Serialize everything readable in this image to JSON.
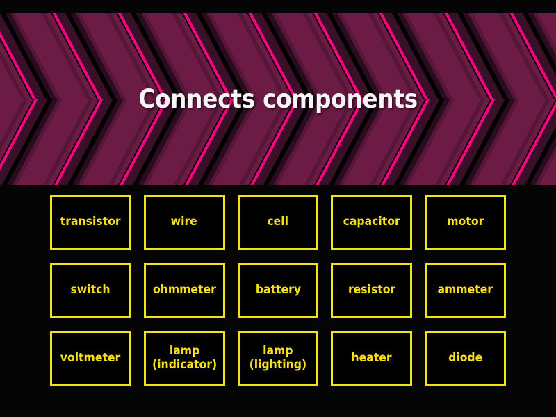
{
  "banner": {
    "title": "Connects components",
    "colors": {
      "background": "#000000",
      "chevron_main": "#6b1b44",
      "chevron_dark": "#3a1028",
      "chevron_mid": "#55163a",
      "chevron_bright": "#f0067f",
      "chevron_deep": "#2a0c1e",
      "title_text": "#f7f5f6"
    }
  },
  "page": {
    "background": "#050505",
    "tile_border": "#f2e414",
    "tile_background": "#000000",
    "tile_text": "#f7e017"
  },
  "grid": {
    "rows": [
      {
        "tiles": [
          {
            "label": "transistor"
          },
          {
            "label": "wire"
          },
          {
            "label": "cell"
          },
          {
            "label": "capacitor"
          },
          {
            "label": "motor"
          }
        ]
      },
      {
        "tiles": [
          {
            "label": "switch"
          },
          {
            "label": "ohmmeter"
          },
          {
            "label": "battery"
          },
          {
            "label": "resistor"
          },
          {
            "label": "ammeter"
          }
        ]
      },
      {
        "tiles": [
          {
            "label": "voltmeter"
          },
          {
            "label": "lamp\n(indicator)"
          },
          {
            "label": "lamp\n(lighting)"
          },
          {
            "label": "heater"
          },
          {
            "label": "diode"
          }
        ]
      }
    ]
  }
}
